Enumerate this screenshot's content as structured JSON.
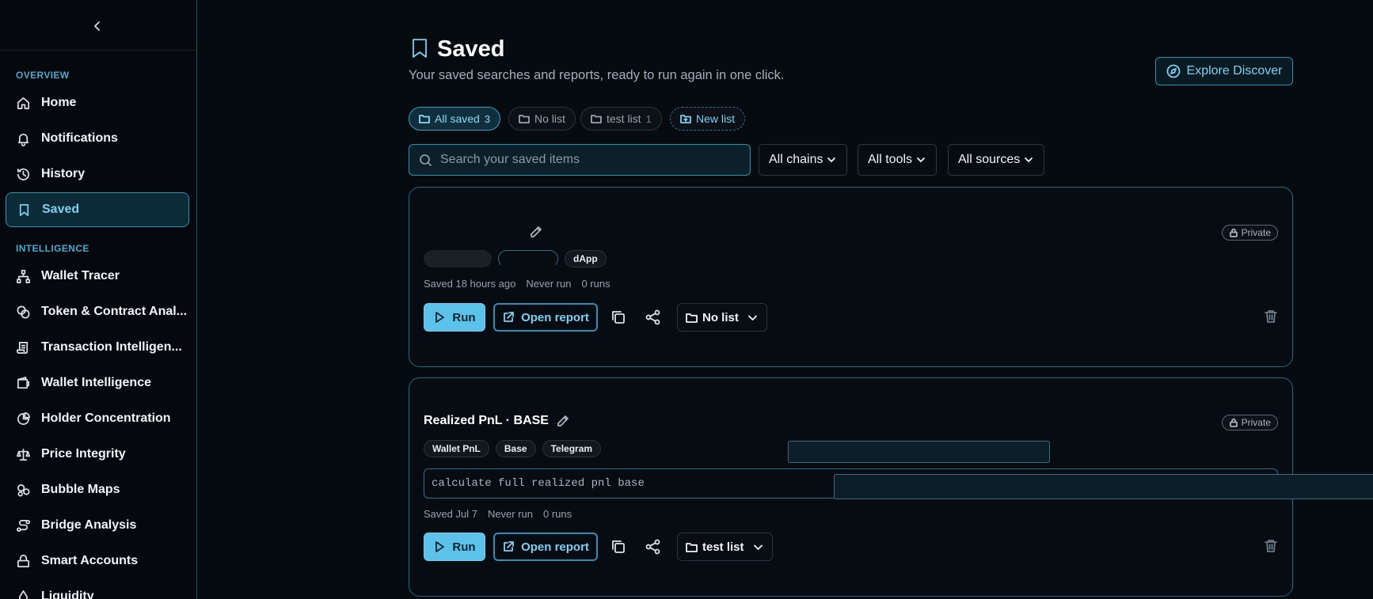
{
  "sidebar": {
    "sections": [
      {
        "label": "OVERVIEW"
      },
      {
        "label": "INTELLIGENCE"
      }
    ],
    "items": [
      {
        "label": "Home",
        "icon": "home-icon"
      },
      {
        "label": "Notifications",
        "icon": "bell-icon"
      },
      {
        "label": "History",
        "icon": "history-icon"
      },
      {
        "label": "Saved",
        "icon": "bookmark-icon",
        "active": true
      },
      {
        "label": "Wallet Tracer",
        "icon": "network-icon"
      },
      {
        "label": "Token & Contract Anal...",
        "icon": "coins-icon"
      },
      {
        "label": "Transaction Intelligen...",
        "icon": "scroll-icon"
      },
      {
        "label": "Wallet Intelligence",
        "icon": "wallet-icon"
      },
      {
        "label": "Holder Concentration",
        "icon": "pie-chart-icon"
      },
      {
        "label": "Price Integrity",
        "icon": "scale-icon"
      },
      {
        "label": "Bubble Maps",
        "icon": "bubbles-icon"
      },
      {
        "label": "Bridge Analysis",
        "icon": "bridge-icon"
      },
      {
        "label": "Smart Accounts",
        "icon": "smart-account-icon"
      },
      {
        "label": "Liquidity",
        "icon": "liquidity-icon"
      }
    ]
  },
  "header": {
    "title": "Saved",
    "subtitle": "Your saved searches and reports, ready to run again in one click.",
    "explore_label": "Explore Discover"
  },
  "lists": [
    {
      "label": "All saved",
      "count": "3",
      "active": true
    },
    {
      "label": "No list",
      "count": ""
    },
    {
      "label": "test list",
      "count": "1"
    },
    {
      "label": "New list",
      "count": ""
    }
  ],
  "filters": {
    "search_placeholder": "Search your saved items",
    "chains": "All chains",
    "tools": "All tools",
    "sources": "All sources"
  },
  "cards": [
    {
      "title": "",
      "visibility": "Private",
      "tags": [
        "dApp"
      ],
      "saved": "Saved 18 hours ago",
      "last_run": "Never run",
      "runs": "0 runs",
      "run_label": "Run",
      "open_label": "Open report",
      "list": "No list"
    },
    {
      "title": "Realized PnL · BASE",
      "visibility": "Private",
      "tags": [
        "Wallet PnL",
        "Base",
        "Telegram"
      ],
      "query": "calculate full realized pnl base",
      "saved": "Saved Jul 7",
      "last_run": "Never run",
      "runs": "0 runs",
      "run_label": "Run",
      "open_label": "Open report",
      "list": "test list"
    }
  ],
  "colors": {
    "accent": "#5cc2ea",
    "accent_text": "#7fd0f0",
    "border_accent": "#2c8fb3",
    "background": "#060b10"
  }
}
